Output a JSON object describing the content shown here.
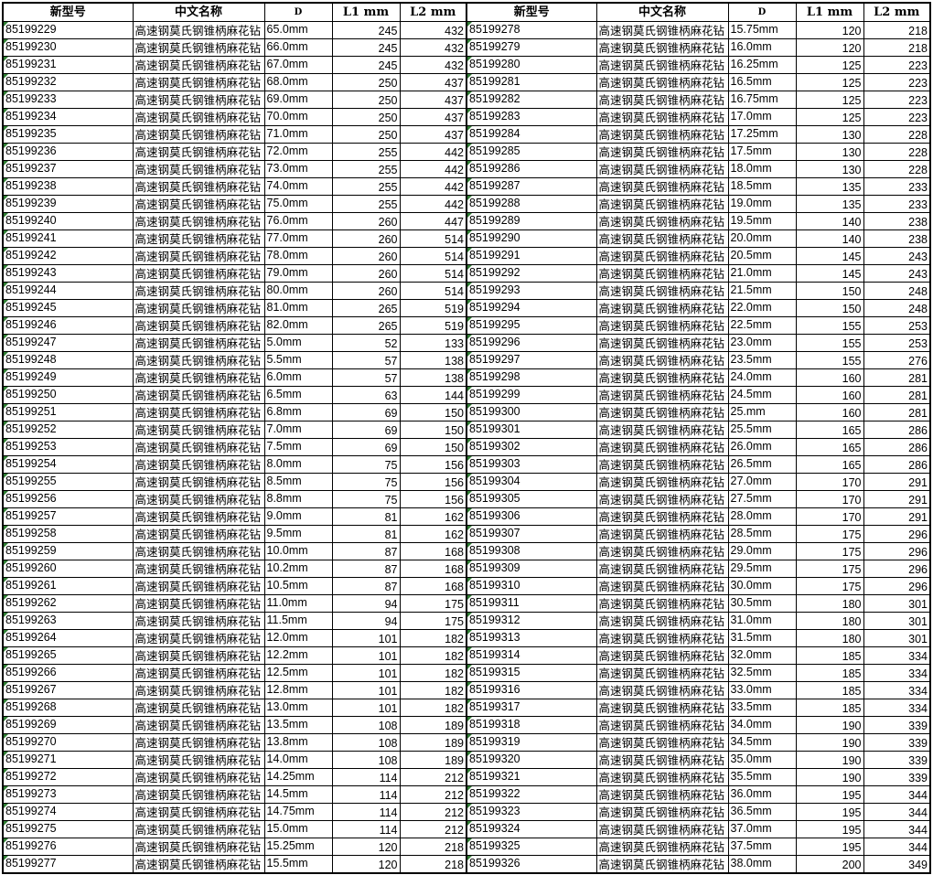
{
  "headers": [
    "新型号",
    "中文名称",
    "D",
    "L1 mm",
    "L2 mm"
  ],
  "rows": [
    [
      [
        "85199229",
        "高速钢莫氏钢锥柄麻花钻",
        "65.0mm",
        "245",
        "432"
      ],
      [
        "85199278",
        "高速钢莫氏钢锥柄麻花钻",
        "15.75mm",
        "120",
        "218"
      ]
    ],
    [
      [
        "85199230",
        "高速钢莫氏钢锥柄麻花钻",
        "66.0mm",
        "245",
        "432"
      ],
      [
        "85199279",
        "高速钢莫氏钢锥柄麻花钻",
        "16.0mm",
        "120",
        "218"
      ]
    ],
    [
      [
        "85199231",
        "高速钢莫氏钢锥柄麻花钻",
        "67.0mm",
        "245",
        "432"
      ],
      [
        "85199280",
        "高速钢莫氏钢锥柄麻花钻",
        "16.25mm",
        "125",
        "223"
      ]
    ],
    [
      [
        "85199232",
        "高速钢莫氏钢锥柄麻花钻",
        "68.0mm",
        "250",
        "437"
      ],
      [
        "85199281",
        "高速钢莫氏钢锥柄麻花钻",
        "16.5mm",
        "125",
        "223"
      ]
    ],
    [
      [
        "85199233",
        "高速钢莫氏钢锥柄麻花钻",
        "69.0mm",
        "250",
        "437"
      ],
      [
        "85199282",
        "高速钢莫氏钢锥柄麻花钻",
        "16.75mm",
        "125",
        "223"
      ]
    ],
    [
      [
        "85199234",
        "高速钢莫氏钢锥柄麻花钻",
        "70.0mm",
        "250",
        "437"
      ],
      [
        "85199283",
        "高速钢莫氏钢锥柄麻花钻",
        "17.0mm",
        "125",
        "223"
      ]
    ],
    [
      [
        "85199235",
        "高速钢莫氏钢锥柄麻花钻",
        "71.0mm",
        "250",
        "437"
      ],
      [
        "85199284",
        "高速钢莫氏钢锥柄麻花钻",
        "17.25mm",
        "130",
        "228"
      ]
    ],
    [
      [
        "85199236",
        "高速钢莫氏钢锥柄麻花钻",
        "72.0mm",
        "255",
        "442"
      ],
      [
        "85199285",
        "高速钢莫氏钢锥柄麻花钻",
        "17.5mm",
        "130",
        "228"
      ]
    ],
    [
      [
        "85199237",
        "高速钢莫氏钢锥柄麻花钻",
        "73.0mm",
        "255",
        "442"
      ],
      [
        "85199286",
        "高速钢莫氏钢锥柄麻花钻",
        "18.0mm",
        "130",
        "228"
      ]
    ],
    [
      [
        "85199238",
        "高速钢莫氏钢锥柄麻花钻",
        "74.0mm",
        "255",
        "442"
      ],
      [
        "85199287",
        "高速钢莫氏钢锥柄麻花钻",
        "18.5mm",
        "135",
        "233"
      ]
    ],
    [
      [
        "85199239",
        "高速钢莫氏钢锥柄麻花钻",
        "75.0mm",
        "255",
        "442"
      ],
      [
        "85199288",
        "高速钢莫氏钢锥柄麻花钻",
        "19.0mm",
        "135",
        "233"
      ]
    ],
    [
      [
        "85199240",
        "高速钢莫氏钢锥柄麻花钻",
        "76.0mm",
        "260",
        "447"
      ],
      [
        "85199289",
        "高速钢莫氏钢锥柄麻花钻",
        "19.5mm",
        "140",
        "238"
      ]
    ],
    [
      [
        "85199241",
        "高速钢莫氏钢锥柄麻花钻",
        "77.0mm",
        "260",
        "514"
      ],
      [
        "85199290",
        "高速钢莫氏钢锥柄麻花钻",
        "20.0mm",
        "140",
        "238"
      ]
    ],
    [
      [
        "85199242",
        "高速钢莫氏钢锥柄麻花钻",
        "78.0mm",
        "260",
        "514"
      ],
      [
        "85199291",
        "高速钢莫氏钢锥柄麻花钻",
        "20.5mm",
        "145",
        "243"
      ]
    ],
    [
      [
        "85199243",
        "高速钢莫氏钢锥柄麻花钻",
        "79.0mm",
        "260",
        "514"
      ],
      [
        "85199292",
        "高速钢莫氏钢锥柄麻花钻",
        "21.0mm",
        "145",
        "243"
      ]
    ],
    [
      [
        "85199244",
        "高速钢莫氏钢锥柄麻花钻",
        "80.0mm",
        "260",
        "514"
      ],
      [
        "85199293",
        "高速钢莫氏钢锥柄麻花钻",
        "21.5mm",
        "150",
        "248"
      ]
    ],
    [
      [
        "85199245",
        "高速钢莫氏钢锥柄麻花钻",
        "81.0mm",
        "265",
        "519"
      ],
      [
        "85199294",
        "高速钢莫氏钢锥柄麻花钻",
        "22.0mm",
        "150",
        "248"
      ]
    ],
    [
      [
        "85199246",
        "高速钢莫氏钢锥柄麻花钻",
        "82.0mm",
        "265",
        "519"
      ],
      [
        "85199295",
        "高速钢莫氏钢锥柄麻花钻",
        "22.5mm",
        "155",
        "253"
      ]
    ],
    [
      [
        "85199247",
        "高速钢莫氏钢锥柄麻花钻",
        "5.0mm",
        "52",
        "133"
      ],
      [
        "85199296",
        "高速钢莫氏钢锥柄麻花钻",
        "23.0mm",
        "155",
        "253"
      ]
    ],
    [
      [
        "85199248",
        "高速钢莫氏钢锥柄麻花钻",
        "5.5mm",
        "57",
        "138"
      ],
      [
        "85199297",
        "高速钢莫氏钢锥柄麻花钻",
        "23.5mm",
        "155",
        "276"
      ]
    ],
    [
      [
        "85199249",
        "高速钢莫氏钢锥柄麻花钻",
        "6.0mm",
        "57",
        "138"
      ],
      [
        "85199298",
        "高速钢莫氏钢锥柄麻花钻",
        "24.0mm",
        "160",
        "281"
      ]
    ],
    [
      [
        "85199250",
        "高速钢莫氏钢锥柄麻花钻",
        "6.5mm",
        "63",
        "144"
      ],
      [
        "85199299",
        "高速钢莫氏钢锥柄麻花钻",
        "24.5mm",
        "160",
        "281"
      ]
    ],
    [
      [
        "85199251",
        "高速钢莫氏钢锥柄麻花钻",
        "6.8mm",
        "69",
        "150"
      ],
      [
        "85199300",
        "高速钢莫氏钢锥柄麻花钻",
        "25.mm",
        "160",
        "281"
      ]
    ],
    [
      [
        "85199252",
        "高速钢莫氏钢锥柄麻花钻",
        "7.0mm",
        "69",
        "150"
      ],
      [
        "85199301",
        "高速钢莫氏钢锥柄麻花钻",
        "25.5mm",
        "165",
        "286"
      ]
    ],
    [
      [
        "85199253",
        "高速钢莫氏钢锥柄麻花钻",
        "7.5mm",
        "69",
        "150"
      ],
      [
        "85199302",
        "高速钢莫氏钢锥柄麻花钻",
        "26.0mm",
        "165",
        "286"
      ]
    ],
    [
      [
        "85199254",
        "高速钢莫氏钢锥柄麻花钻",
        "8.0mm",
        "75",
        "156"
      ],
      [
        "85199303",
        "高速钢莫氏钢锥柄麻花钻",
        "26.5mm",
        "165",
        "286"
      ]
    ],
    [
      [
        "85199255",
        "高速钢莫氏钢锥柄麻花钻",
        "8.5mm",
        "75",
        "156"
      ],
      [
        "85199304",
        "高速钢莫氏钢锥柄麻花钻",
        "27.0mm",
        "170",
        "291"
      ]
    ],
    [
      [
        "85199256",
        "高速钢莫氏钢锥柄麻花钻",
        "8.8mm",
        "75",
        "156"
      ],
      [
        "85199305",
        "高速钢莫氏钢锥柄麻花钻",
        "27.5mm",
        "170",
        "291"
      ]
    ],
    [
      [
        "85199257",
        "高速钢莫氏钢锥柄麻花钻",
        "9.0mm",
        "81",
        "162"
      ],
      [
        "85199306",
        "高速钢莫氏钢锥柄麻花钻",
        "28.0mm",
        "170",
        "291"
      ]
    ],
    [
      [
        "85199258",
        "高速钢莫氏钢锥柄麻花钻",
        "9.5mm",
        "81",
        "162"
      ],
      [
        "85199307",
        "高速钢莫氏钢锥柄麻花钻",
        "28.5mm",
        "175",
        "296"
      ]
    ],
    [
      [
        "85199259",
        "高速钢莫氏钢锥柄麻花钻",
        "10.0mm",
        "87",
        "168"
      ],
      [
        "85199308",
        "高速钢莫氏钢锥柄麻花钻",
        "29.0mm",
        "175",
        "296"
      ]
    ],
    [
      [
        "85199260",
        "高速钢莫氏钢锥柄麻花钻",
        "10.2mm",
        "87",
        "168"
      ],
      [
        "85199309",
        "高速钢莫氏钢锥柄麻花钻",
        "29.5mm",
        "175",
        "296"
      ]
    ],
    [
      [
        "85199261",
        "高速钢莫氏钢锥柄麻花钻",
        "10.5mm",
        "87",
        "168"
      ],
      [
        "85199310",
        "高速钢莫氏钢锥柄麻花钻",
        "30.0mm",
        "175",
        "296"
      ]
    ],
    [
      [
        "85199262",
        "高速钢莫氏钢锥柄麻花钻",
        "11.0mm",
        "94",
        "175"
      ],
      [
        "85199311",
        "高速钢莫氏钢锥柄麻花钻",
        "30.5mm",
        "180",
        "301"
      ]
    ],
    [
      [
        "85199263",
        "高速钢莫氏钢锥柄麻花钻",
        "11.5mm",
        "94",
        "175"
      ],
      [
        "85199312",
        "高速钢莫氏钢锥柄麻花钻",
        "31.0mm",
        "180",
        "301"
      ]
    ],
    [
      [
        "85199264",
        "高速钢莫氏钢锥柄麻花钻",
        "12.0mm",
        "101",
        "182"
      ],
      [
        "85199313",
        "高速钢莫氏钢锥柄麻花钻",
        "31.5mm",
        "180",
        "301"
      ]
    ],
    [
      [
        "85199265",
        "高速钢莫氏钢锥柄麻花钻",
        "12.2mm",
        "101",
        "182"
      ],
      [
        "85199314",
        "高速钢莫氏钢锥柄麻花钻",
        "32.0mm",
        "185",
        "334"
      ]
    ],
    [
      [
        "85199266",
        "高速钢莫氏钢锥柄麻花钻",
        "12.5mm",
        "101",
        "182"
      ],
      [
        "85199315",
        "高速钢莫氏钢锥柄麻花钻",
        "32.5mm",
        "185",
        "334"
      ]
    ],
    [
      [
        "85199267",
        "高速钢莫氏钢锥柄麻花钻",
        "12.8mm",
        "101",
        "182"
      ],
      [
        "85199316",
        "高速钢莫氏钢锥柄麻花钻",
        "33.0mm",
        "185",
        "334"
      ]
    ],
    [
      [
        "85199268",
        "高速钢莫氏钢锥柄麻花钻",
        "13.0mm",
        "101",
        "182"
      ],
      [
        "85199317",
        "高速钢莫氏钢锥柄麻花钻",
        "33.5mm",
        "185",
        "334"
      ]
    ],
    [
      [
        "85199269",
        "高速钢莫氏钢锥柄麻花钻",
        "13.5mm",
        "108",
        "189"
      ],
      [
        "85199318",
        "高速钢莫氏钢锥柄麻花钻",
        "34.0mm",
        "190",
        "339"
      ]
    ],
    [
      [
        "85199270",
        "高速钢莫氏钢锥柄麻花钻",
        "13.8mm",
        "108",
        "189"
      ],
      [
        "85199319",
        "高速钢莫氏钢锥柄麻花钻",
        "34.5mm",
        "190",
        "339"
      ]
    ],
    [
      [
        "85199271",
        "高速钢莫氏钢锥柄麻花钻",
        "14.0mm",
        "108",
        "189"
      ],
      [
        "85199320",
        "高速钢莫氏钢锥柄麻花钻",
        "35.0mm",
        "190",
        "339"
      ]
    ],
    [
      [
        "85199272",
        "高速钢莫氏钢锥柄麻花钻",
        "14.25mm",
        "114",
        "212"
      ],
      [
        "85199321",
        "高速钢莫氏钢锥柄麻花钻",
        "35.5mm",
        "190",
        "339"
      ]
    ],
    [
      [
        "85199273",
        "高速钢莫氏钢锥柄麻花钻",
        "14.5mm",
        "114",
        "212"
      ],
      [
        "85199322",
        "高速钢莫氏钢锥柄麻花钻",
        "36.0mm",
        "195",
        "344"
      ]
    ],
    [
      [
        "85199274",
        "高速钢莫氏钢锥柄麻花钻",
        "14.75mm",
        "114",
        "212"
      ],
      [
        "85199323",
        "高速钢莫氏钢锥柄麻花钻",
        "36.5mm",
        "195",
        "344"
      ]
    ],
    [
      [
        "85199275",
        "高速钢莫氏钢锥柄麻花钻",
        "15.0mm",
        "114",
        "212"
      ],
      [
        "85199324",
        "高速钢莫氏钢锥柄麻花钻",
        "37.0mm",
        "195",
        "344"
      ]
    ],
    [
      [
        "85199276",
        "高速钢莫氏钢锥柄麻花钻",
        "15.25mm",
        "120",
        "218"
      ],
      [
        "85199325",
        "高速钢莫氏钢锥柄麻花钻",
        "37.5mm",
        "195",
        "344"
      ]
    ],
    [
      [
        "85199277",
        "高速钢莫氏钢锥柄麻花钻",
        "15.5mm",
        "120",
        "218"
      ],
      [
        "85199326",
        "高速钢莫氏钢锥柄麻花钻",
        "38.0mm",
        "200",
        "349"
      ]
    ]
  ]
}
